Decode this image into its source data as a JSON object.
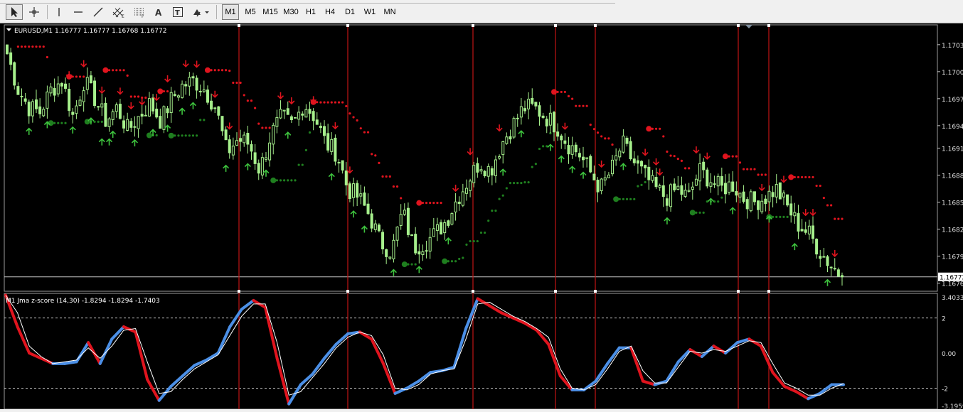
{
  "toolbar": {
    "tools": [
      {
        "name": "cursor-tool",
        "icon": "arrow-cursor-icon"
      },
      {
        "name": "crosshair-tool",
        "icon": "crosshair-icon"
      },
      {
        "name": "vertical-line-tool",
        "icon": "vertical-line-icon"
      },
      {
        "name": "horizontal-line-tool",
        "icon": "horizontal-line-icon"
      },
      {
        "name": "trendline-tool",
        "icon": "trendline-icon"
      },
      {
        "name": "equidistant-channel-tool",
        "icon": "channel-icon"
      },
      {
        "name": "fibonacci-tool",
        "icon": "fibonacci-icon"
      },
      {
        "name": "text-tool",
        "icon": "text-a-icon"
      },
      {
        "name": "text-label-tool",
        "icon": "text-label-icon"
      },
      {
        "name": "arrows-tool",
        "icon": "arrows-dropdown-icon"
      }
    ],
    "timeframes": [
      "M1",
      "M5",
      "M15",
      "M30",
      "H1",
      "H4",
      "D1",
      "W1",
      "MN"
    ],
    "active_timeframe": "M1"
  },
  "main_chart": {
    "header": "EURUSD,M1  1.16777 1.16777 1.16768 1.16772",
    "price_labels": [
      "1.17030",
      "1.17000",
      "1.16970",
      "1.16940",
      "1.16915",
      "1.16885",
      "1.16855",
      "1.16825",
      "1.16795",
      "1.16765"
    ],
    "current_price_label": "1.16772"
  },
  "sub_chart": {
    "header": "M1 Jma z-score (14,30) -1.8294 -1.8294 -1.7403",
    "labels": [
      "3.4033",
      "2",
      "0.00",
      "-2",
      "-3.1959"
    ]
  },
  "chart_data": [
    {
      "type": "candlestick",
      "symbol": "EURUSD",
      "timeframe": "M1",
      "ylim": [
        1.16756,
        1.17052
      ],
      "ticks": [
        1.1703,
        1.17,
        1.1697,
        1.1694,
        1.16915,
        1.16885,
        1.16855,
        1.16825,
        1.16795,
        1.16765
      ],
      "last": {
        "open": 1.16777,
        "high": 1.16777,
        "low": 1.16768,
        "close": 1.16772
      },
      "candle_count": 230,
      "close_path": [
        1.1702,
        1.1698,
        1.1696,
        1.16955,
        1.1698,
        1.1699,
        1.1695,
        1.1699,
        1.1697,
        1.16945,
        1.1696,
        1.16935,
        1.1695,
        1.16965,
        1.16945,
        1.1697,
        1.16985,
        1.1699,
        1.1698,
        1.1696,
        1.1691,
        1.16925,
        1.1692,
        1.1689,
        1.1693,
        1.1695,
        1.1694,
        1.16965,
        1.1695,
        1.1692,
        1.1691,
        1.1687,
        1.1686,
        1.1684,
        1.1681,
        1.168,
        1.16845,
        1.16805,
        1.1681,
        1.1682,
        1.16835,
        1.1686,
        1.1688,
        1.169,
        1.1689,
        1.1692,
        1.1694,
        1.1696,
        1.1696,
        1.1695,
        1.1694,
        1.1692,
        1.1691,
        1.1689,
        1.1687,
        1.1689,
        1.1692,
        1.169,
        1.16885,
        1.1687,
        1.1686,
        1.1687,
        1.1686,
        1.1689,
        1.1688,
        1.1687,
        1.16875,
        1.1686,
        1.16855,
        1.1686,
        1.1687,
        1.1685,
        1.1683,
        1.1682,
        1.168,
        1.16785,
        1.16772
      ],
      "signals": {
        "sell_arrows_x": [
          22,
          28,
          34,
          40,
          44,
          48,
          54,
          58,
          64,
          68,
          74,
          80,
          98,
          102,
          110,
          118,
          122,
          160,
          166,
          176,
          200,
          212,
          228,
          232,
          234,
          246,
          250,
          270,
          278,
          286,
          288,
          296
        ],
        "buy_arrows_x": [
          8,
          14,
          24,
          30,
          34,
          36,
          38,
          46,
          52,
          58,
          62,
          66,
          78,
          86,
          92,
          100,
          116,
          124,
          128,
          138,
          148,
          158,
          178,
          184,
          194,
          198,
          202,
          206,
          220,
          236,
          252,
          260,
          272,
          282,
          294
        ]
      },
      "vertical_lines_x": [
        336,
        489,
        665,
        781,
        837,
        1038,
        1081
      ]
    },
    {
      "type": "line",
      "title": "M1 Jma z-score (14,30)",
      "ylim": [
        -3.1959,
        3.4033
      ],
      "levels": [
        2,
        0,
        -2
      ],
      "last_values": [
        -1.8294,
        -1.8294,
        -1.7403
      ],
      "series": [
        {
          "style": "thick",
          "up_color": "#4b8fe6",
          "down_color": "#e0141e",
          "values": [
            3.3,
            1.5,
            0.0,
            -0.3,
            -0.6,
            -0.6,
            -0.5,
            0.6,
            -0.6,
            0.8,
            1.5,
            1.2,
            -1.5,
            -2.7,
            -1.9,
            -1.3,
            -0.7,
            -0.4,
            0.0,
            1.5,
            2.5,
            3.0,
            2.6,
            -0.3,
            -2.9,
            -1.8,
            -1.2,
            -0.3,
            0.5,
            1.1,
            1.2,
            0.8,
            -0.6,
            -2.3,
            -2.0,
            -1.6,
            -1.1,
            -1.0,
            -0.8,
            1.4,
            3.1,
            2.7,
            2.3,
            2.0,
            1.7,
            1.3,
            0.5,
            -1.3,
            -2.1,
            -2.1,
            -1.6,
            -0.6,
            0.3,
            0.3,
            -1.6,
            -1.8,
            -1.6,
            -0.5,
            0.2,
            -0.2,
            0.4,
            0.0,
            0.6,
            0.8,
            0.4,
            -1.1,
            -1.9,
            -2.2,
            -2.6,
            -2.3,
            -1.8,
            -1.8
          ]
        },
        {
          "style": "thin",
          "color": "#ffffff",
          "values": [
            3.3,
            2.3,
            0.4,
            -0.2,
            -0.6,
            -0.5,
            -0.4,
            0.3,
            -0.3,
            0.4,
            1.3,
            1.4,
            -0.5,
            -2.3,
            -2.2,
            -1.5,
            -0.9,
            -0.5,
            -0.1,
            1.0,
            2.1,
            2.8,
            2.8,
            0.6,
            -2.4,
            -2.2,
            -1.4,
            -0.6,
            0.3,
            0.9,
            1.2,
            1.0,
            -0.1,
            -2.0,
            -2.1,
            -1.8,
            -1.2,
            -1.0,
            -0.9,
            0.8,
            2.8,
            2.9,
            2.5,
            2.1,
            1.8,
            1.4,
            0.9,
            -0.9,
            -2.0,
            -2.1,
            -1.8,
            -0.9,
            0.1,
            0.4,
            -1.0,
            -1.7,
            -1.7,
            -0.8,
            0.1,
            0.0,
            0.2,
            0.1,
            0.4,
            0.7,
            0.6,
            -0.6,
            -1.7,
            -2.0,
            -2.4,
            -2.4,
            -2.0,
            -1.74
          ]
        }
      ],
      "vertical_lines_x": [
        336,
        489,
        665,
        781,
        837,
        1038,
        1081
      ]
    }
  ],
  "colors": {
    "background": "#000000",
    "candle_bull": "#a6f08c",
    "candle_bear": "#5fc24a",
    "sell_arrow": "#e0141e",
    "buy_arrow": "#3ec43e",
    "dots_red": "#e0141e",
    "dots_green": "#1f7f1f",
    "grid_level": "#bfbfbf",
    "separator": "#d0d0d0",
    "vline": "#c01414"
  }
}
